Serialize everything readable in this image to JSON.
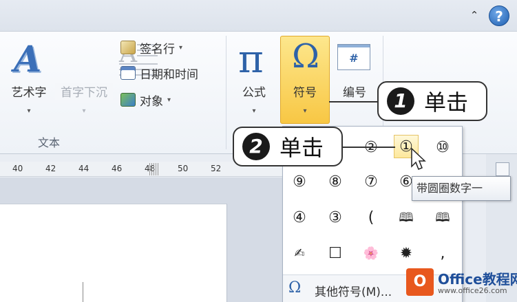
{
  "titlebar": {
    "caret": "⌃",
    "help": "?"
  },
  "ribbon": {
    "wordart_label": "艺术字",
    "dropcap_label": "首字下沉",
    "signature_label": "签名行",
    "datetime_label": "日期和时间",
    "object_label": "对象",
    "group_text_label": "文本",
    "equation_label": "公式",
    "symbol_label": "符号",
    "number_label": "编号",
    "number_glyph": "#",
    "dropdown_arrow": "▾"
  },
  "ruler": {
    "ticks": [
      "40",
      "42",
      "44",
      "46",
      "48",
      "50",
      "52"
    ]
  },
  "symbol_panel": {
    "symbols": [
      "②",
      "①",
      "⑩",
      "⑨",
      "⑧",
      "⑦",
      "⑥",
      "④",
      "③",
      "(",
      "🕮",
      "🕮",
      "✍",
      "☐",
      "🌸",
      "✹",
      ","
    ],
    "more_label": "其他符号(M)...",
    "more_icon": "Ω"
  },
  "tooltip": {
    "text": "带圆圈数字一"
  },
  "callouts": [
    {
      "number": "1",
      "text": "单击"
    },
    {
      "number": "2",
      "text": "单击"
    }
  ],
  "watermark": {
    "logo": "O",
    "brand": "Office教程网",
    "url": "www.office26.com"
  },
  "colors": {
    "accent": "#2e62a8",
    "highlight": "#f8c744"
  }
}
